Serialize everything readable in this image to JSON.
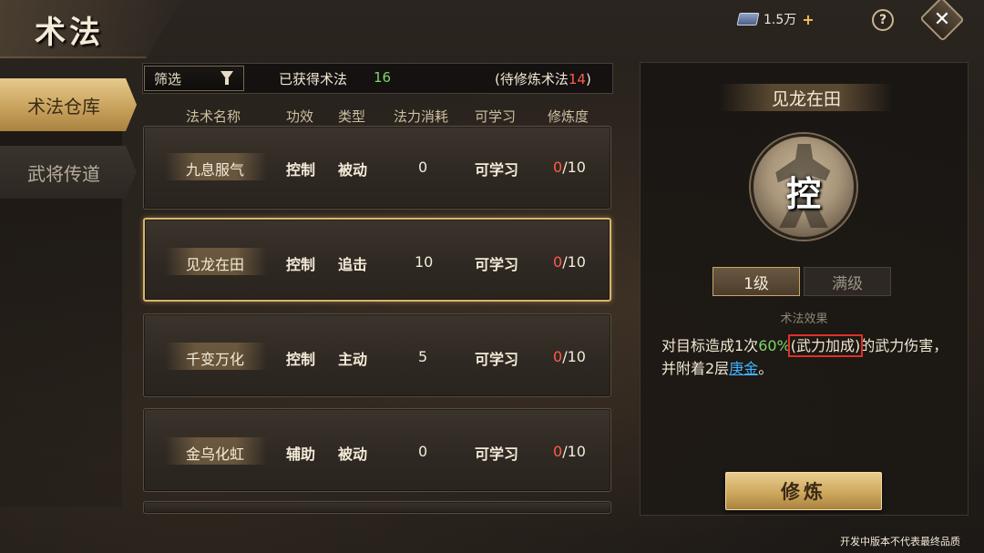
{
  "header": {
    "title": "术法"
  },
  "currency": {
    "amount": "1.5万",
    "plus": "+"
  },
  "help": {
    "label": "?"
  },
  "close": {
    "label": "✕"
  },
  "nav": {
    "tabs": [
      {
        "label": "术法仓库",
        "active": true
      },
      {
        "label": "武将传道",
        "active": false
      }
    ]
  },
  "filter": {
    "select_label": "筛选",
    "obtained_label": "已获得术法",
    "obtained_count": "16",
    "pending_prefix": "(待修炼术法",
    "pending_count": "14",
    "pending_suffix": ")"
  },
  "table": {
    "columns": [
      "法术名称",
      "功效",
      "类型",
      "法力消耗",
      "可学习",
      "修炼度"
    ],
    "rows": [
      {
        "name": "九息服气",
        "effect": "控制",
        "type": "被动",
        "cost": "0",
        "learn": "可学习",
        "progress_current": "0",
        "progress_total": "/10",
        "selected": false
      },
      {
        "name": "见龙在田",
        "effect": "控制",
        "type": "追击",
        "cost": "10",
        "learn": "可学习",
        "progress_current": "0",
        "progress_total": "/10",
        "selected": true
      },
      {
        "name": "千变万化",
        "effect": "控制",
        "type": "主动",
        "cost": "5",
        "learn": "可学习",
        "progress_current": "0",
        "progress_total": "/10",
        "selected": false
      },
      {
        "name": "金乌化虹",
        "effect": "辅助",
        "type": "被动",
        "cost": "0",
        "learn": "可学习",
        "progress_current": "0",
        "progress_total": "/10",
        "selected": false
      }
    ]
  },
  "detail": {
    "title": "见龙在田",
    "emblem_char": "控",
    "level_tabs": [
      "1级",
      "满级"
    ],
    "effect_label": "术法效果",
    "effect": {
      "part1": "对目标造成1次",
      "pct": "60%",
      "boxed": "(武力加成)",
      "part2": "的武力伤害，并附着2层",
      "buff": "庚金",
      "end": "。"
    },
    "train_label": "修炼"
  },
  "footer": {
    "disclaimer": "开发中版本不代表最终品质"
  },
  "colors": {
    "accent_gold": "#d9b46a",
    "progress_red": "#ff5a4a",
    "value_green": "#7fd66b",
    "link_blue": "#3fb3ff"
  }
}
